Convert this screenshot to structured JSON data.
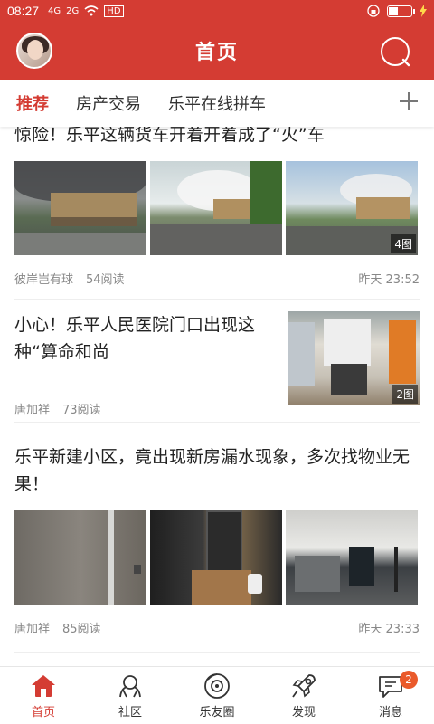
{
  "status_bar": {
    "time": "08:27",
    "network_1": "4G",
    "network_2": "2G",
    "hd": "HD",
    "battery_level": 0.4
  },
  "header": {
    "title": "首页"
  },
  "tabs": [
    {
      "label": "推荐",
      "active": true
    },
    {
      "label": "房产交易",
      "active": false
    },
    {
      "label": "乐平在线拼车",
      "active": false
    }
  ],
  "articles": [
    {
      "title": "惊险！乐平这辆货车开着开着成了“火”车",
      "author": "彼岸岂有球",
      "reads": "54阅读",
      "time": "昨天 23:52",
      "image_count": "4图"
    },
    {
      "title": "小心！乐平人民医院门口出现这种“算命和尚",
      "author": "唐加祥",
      "reads": "73阅读",
      "time": "",
      "image_count": "2图"
    },
    {
      "title": "乐平新建小区，竟出现新房漏水现象，多次找物业无果！",
      "author": "唐加祥",
      "reads": "85阅读",
      "time": "昨天 23:33",
      "image_count": ""
    }
  ],
  "bottom_nav": [
    {
      "label": "首页",
      "icon": "home-icon",
      "active": true
    },
    {
      "label": "社区",
      "icon": "community-icon",
      "active": false
    },
    {
      "label": "乐友圈",
      "icon": "friends-circle-icon",
      "active": false
    },
    {
      "label": "发现",
      "icon": "discover-rocket-icon",
      "active": false
    },
    {
      "label": "消息",
      "icon": "message-icon",
      "active": false,
      "badge": "2"
    }
  ],
  "colors": {
    "brand_red": "#d43c33",
    "badge_orange": "#ea5a2b"
  }
}
